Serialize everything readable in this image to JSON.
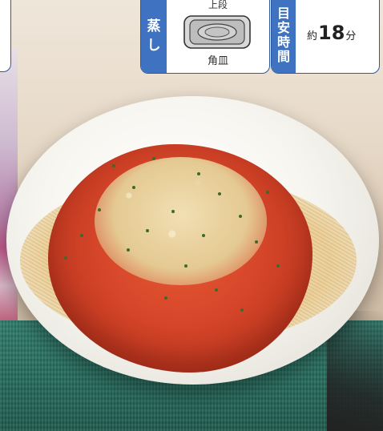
{
  "cooking_mode": {
    "label_chars": [
      "蒸",
      "し"
    ],
    "rack_position": "上段",
    "tray_name": "角皿",
    "tray_icon": "tray-icon"
  },
  "time_estimate": {
    "label_chars": [
      "目",
      "安",
      "時",
      "間"
    ],
    "prefix": "約",
    "minutes": "18",
    "unit": "分"
  },
  "colors": {
    "panel_blue": "#3f73c2",
    "panel_border": "#2e5a9c"
  }
}
